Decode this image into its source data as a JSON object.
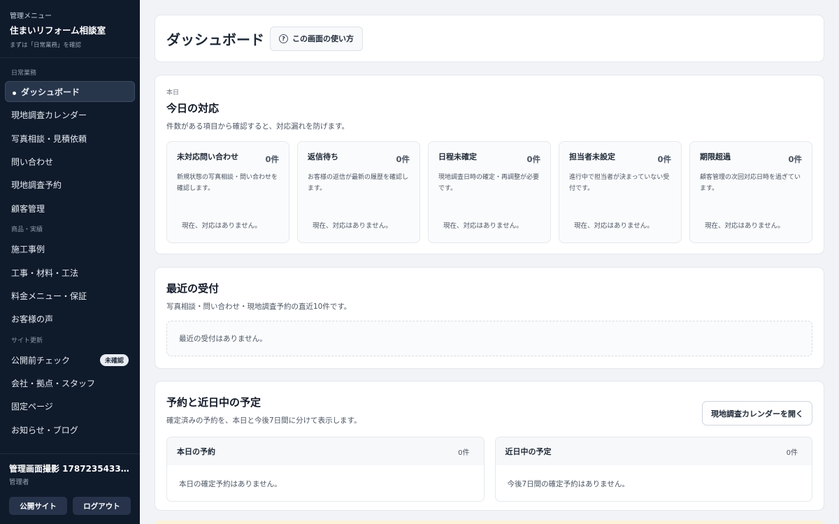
{
  "sidebar": {
    "kicker": "管理メニュー",
    "title": "住まいリフォーム相談室",
    "subtitle": "まずは「日常業務」を確認",
    "groups": [
      {
        "label": "日常業務",
        "items": [
          {
            "label": "ダッシュボード",
            "active": true
          },
          {
            "label": "現地調査カレンダー"
          },
          {
            "label": "写真相談・見積依頼"
          },
          {
            "label": "問い合わせ"
          },
          {
            "label": "現地調査予約"
          },
          {
            "label": "顧客管理"
          }
        ]
      },
      {
        "label": "商品・実績",
        "items": [
          {
            "label": "施工事例"
          },
          {
            "label": "工事・材料・工法"
          },
          {
            "label": "料金メニュー・保証"
          },
          {
            "label": "お客様の声"
          }
        ]
      },
      {
        "label": "サイト更新",
        "items": [
          {
            "label": "公開前チェック",
            "badge": "未確認"
          },
          {
            "label": "会社・拠点・スタッフ"
          },
          {
            "label": "固定ページ"
          },
          {
            "label": "お知らせ・ブログ"
          }
        ]
      }
    ],
    "user": {
      "name": "管理画面撮影 17872354334…",
      "role": "管理者"
    },
    "public_site_button": "公開サイト",
    "logout_button": "ログアウト"
  },
  "header": {
    "title": "ダッシュボード",
    "help_button": "この画面の使い方",
    "help_icon": "?"
  },
  "today": {
    "kicker": "本日",
    "title": "今日の対応",
    "description": "件数がある項目から確認すると、対応漏れを防げます。",
    "cards": [
      {
        "label": "未対応問い合わせ",
        "count": "0件",
        "description": "新規状態の写真相談・問い合わせを確認します。",
        "empty": "現在、対応はありません。"
      },
      {
        "label": "返信待ち",
        "count": "0件",
        "description": "お客様の返信が最新の履歴を確認します。",
        "empty": "現在、対応はありません。"
      },
      {
        "label": "日程未確定",
        "count": "0件",
        "description": "現地調査日時の確定・再調整が必要です。",
        "empty": "現在、対応はありません。"
      },
      {
        "label": "担当者未設定",
        "count": "0件",
        "description": "進行中で担当者が決まっていない受付です。",
        "empty": "現在、対応はありません。"
      },
      {
        "label": "期限超過",
        "count": "0件",
        "description": "顧客管理の次回対応日時を過ぎています。",
        "empty": "現在、対応はありません。"
      }
    ]
  },
  "recent": {
    "title": "最近の受付",
    "description": "写真相談・問い合わせ・現地調査予約の直近10件です。",
    "empty": "最近の受付はありません。"
  },
  "schedule": {
    "title": "予約と近日中の予定",
    "description": "確定済みの予約を、本日と今後7日間に分けて表示します。",
    "calendar_button": "現地調査カレンダーを開く",
    "panels": [
      {
        "title": "本日の予約",
        "count": "0件",
        "empty": "本日の確定予約はありません。"
      },
      {
        "title": "近日中の予定",
        "count": "0件",
        "empty": "今後7日間の確定予約はありません。"
      }
    ]
  }
}
